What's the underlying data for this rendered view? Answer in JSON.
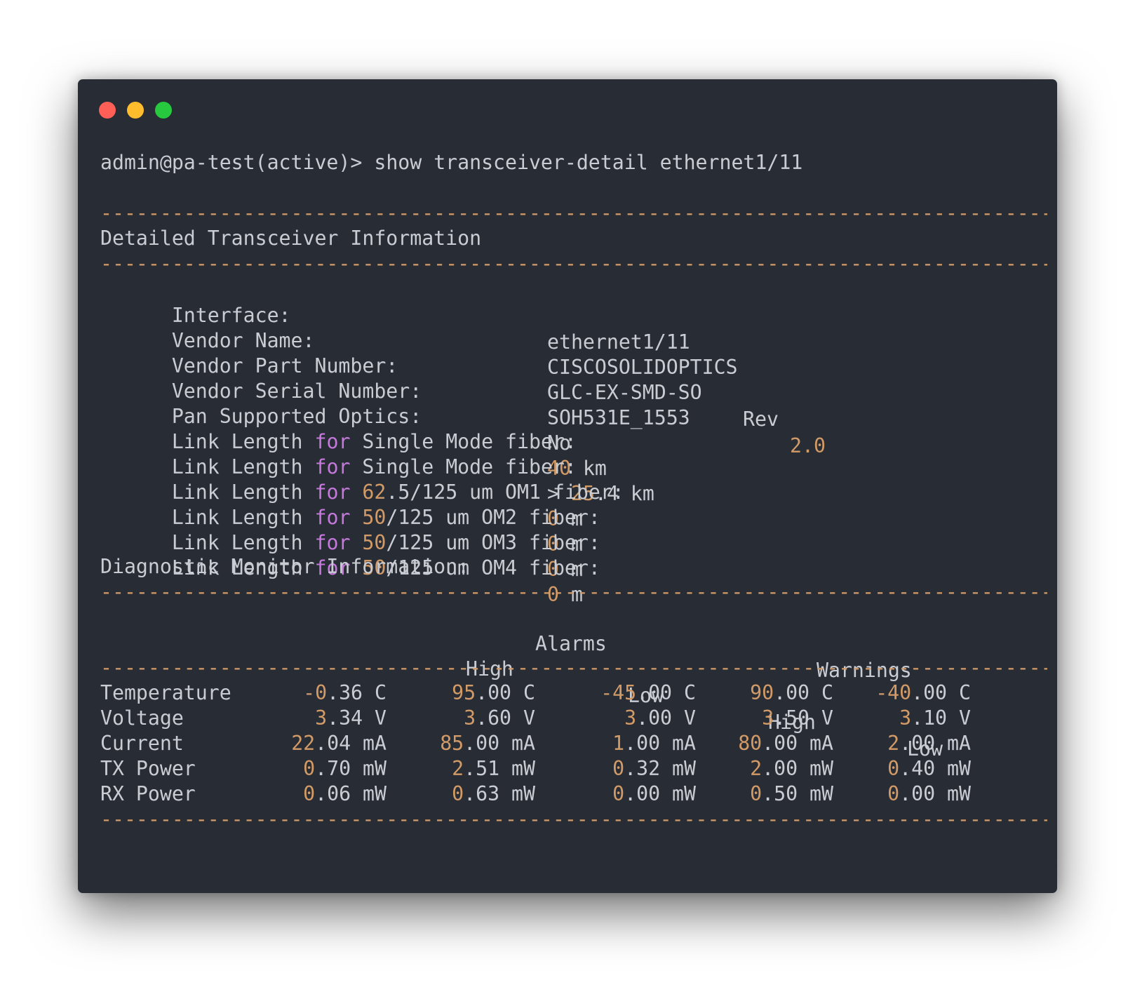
{
  "window": {
    "controls": [
      "close",
      "minimize",
      "maximize"
    ]
  },
  "colors": {
    "background": "#282c34",
    "text": "#c9ccd3",
    "number": "#d19a66",
    "keyword": "#c678dd",
    "rule": "#d19a66"
  },
  "terminal": {
    "prompt": "admin@pa-test(active)>",
    "command": "show transceiver-detail ethernet1/11",
    "rule": "--------------------------------------------------------------------------------",
    "section_title": "Detailed Transceiver Information",
    "info": {
      "interface_label": "Interface:",
      "interface_value": "ethernet1/11",
      "vendor_name_label": "Vendor Name:",
      "vendor_name_value": "CISCOSOLIDOPTICS",
      "part_number_label": "Vendor Part Number:",
      "part_number_value": "GLC-EX-SMD-SO",
      "rev_label": "Rev",
      "rev_value": "2.0",
      "serial_label": "Vendor Serial Number:",
      "serial_value": "SOH531E_1553",
      "pan_label": "Pan Supported Optics:",
      "pan_value": "No",
      "link_prefix": "Link Length",
      "link_keyword": "for",
      "link_sm_km_label": "Single Mode fiber:",
      "link_sm_km_value": "40",
      "link_sm_km_unit": "km",
      "link_sm_100m_label": "Single Mode fiber:",
      "link_sm_100m_prefix": ">",
      "link_sm_100m_int": "25",
      "link_sm_100m_frac": ".4",
      "link_sm_100m_unit": "km",
      "link_om1_size": "62",
      "link_om1_rest": ".5/125 um OM1 fiber:",
      "link_om1_value": "0",
      "link_om1_unit": "m",
      "link_om2_size": "50",
      "link_om2_rest": "/125 um OM2 fiber:",
      "link_om2_value": "0",
      "link_om2_unit": "m",
      "link_om3_size": "50",
      "link_om3_rest": "/125 um OM3 fiber:",
      "link_om3_value": "0",
      "link_om3_unit": "m",
      "link_om4_size": "50",
      "link_om4_rest": "/125 um OM4 fiber:",
      "link_om4_value": "0",
      "link_om4_unit": "m",
      "diag_title": "Diagnostic Monitor Information:"
    },
    "diag_headers": {
      "alarms": "Alarms",
      "warnings": "Warnings",
      "alarm_high": "High",
      "alarm_low": "Low",
      "warning_high": "High",
      "warning_low": "Low"
    },
    "diag_rows": [
      {
        "label": "Temperature",
        "value": [
          "-0",
          ".36",
          "C"
        ],
        "alarm_high": [
          "95",
          ".00",
          "C"
        ],
        "alarm_low": [
          "-45",
          ".00",
          "C"
        ],
        "warning_high": [
          "90",
          ".00",
          "C"
        ],
        "warning_low": [
          "-40",
          ".00",
          "C"
        ]
      },
      {
        "label": "Voltage",
        "value": [
          "3",
          ".34",
          "V"
        ],
        "alarm_high": [
          "3",
          ".60",
          "V"
        ],
        "alarm_low": [
          "3",
          ".00",
          "V"
        ],
        "warning_high": [
          "3",
          ".50",
          "V"
        ],
        "warning_low": [
          "3",
          ".10",
          "V"
        ]
      },
      {
        "label": "Current",
        "value": [
          "22",
          ".04",
          "mA"
        ],
        "alarm_high": [
          "85",
          ".00",
          "mA"
        ],
        "alarm_low": [
          "1",
          ".00",
          "mA"
        ],
        "warning_high": [
          "80",
          ".00",
          "mA"
        ],
        "warning_low": [
          "2",
          ".00",
          "mA"
        ]
      },
      {
        "label": "TX Power",
        "value": [
          "0",
          ".70",
          "mW"
        ],
        "alarm_high": [
          "2",
          ".51",
          "mW"
        ],
        "alarm_low": [
          "0",
          ".32",
          "mW"
        ],
        "warning_high": [
          "2",
          ".00",
          "mW"
        ],
        "warning_low": [
          "0",
          ".40",
          "mW"
        ]
      },
      {
        "label": "RX Power",
        "value": [
          "0",
          ".06",
          "mW"
        ],
        "alarm_high": [
          "0",
          ".63",
          "mW"
        ],
        "alarm_low": [
          "0",
          ".00",
          "mW"
        ],
        "warning_high": [
          "0",
          ".50",
          "mW"
        ],
        "warning_low": [
          "0",
          ".00",
          "mW"
        ]
      }
    ]
  }
}
